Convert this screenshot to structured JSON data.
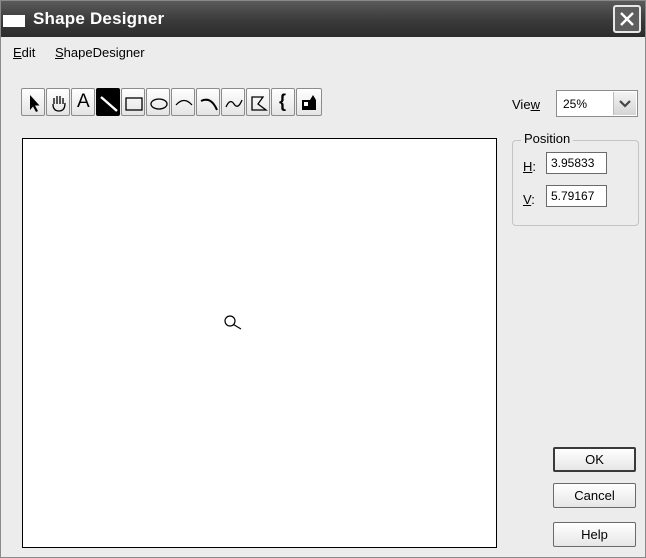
{
  "window": {
    "title": "Shape Designer"
  },
  "menu": {
    "edit": {
      "underline": "E",
      "rest": "dit"
    },
    "shapedesigner": {
      "underline": "S",
      "rest": "hapeDesigner"
    }
  },
  "toolbar": {
    "tools": [
      {
        "name": "pointer",
        "icon": "arrow-pointer-icon",
        "label": ""
      },
      {
        "name": "pan",
        "icon": "hand-icon",
        "label": ""
      },
      {
        "name": "text",
        "icon": "text-icon",
        "label": "A"
      },
      {
        "name": "line",
        "icon": "line-icon",
        "label": "",
        "active": true
      },
      {
        "name": "rectangle",
        "icon": "rectangle-icon",
        "label": ""
      },
      {
        "name": "ellipse",
        "icon": "ellipse-icon",
        "label": ""
      },
      {
        "name": "arc",
        "icon": "arc-icon",
        "label": ""
      },
      {
        "name": "curve",
        "icon": "curve-icon",
        "label": ""
      },
      {
        "name": "freehand",
        "icon": "wave-icon",
        "label": ""
      },
      {
        "name": "polygon",
        "icon": "polygon-icon",
        "label": ""
      },
      {
        "name": "bracket",
        "icon": "brace-icon",
        "label": "{"
      },
      {
        "name": "image",
        "icon": "image-icon",
        "label": ""
      }
    ]
  },
  "view": {
    "label_pre": "Vie",
    "label_u": "w",
    "value": "25%"
  },
  "position": {
    "legend": "Position",
    "h_label_u": "H",
    "h_label_rest": ":",
    "h_value": "3.95833",
    "v_label_u": "V",
    "v_label_rest": ":",
    "v_value": "5.79167"
  },
  "buttons": {
    "ok": "OK",
    "cancel": "Cancel",
    "help": "Help"
  }
}
